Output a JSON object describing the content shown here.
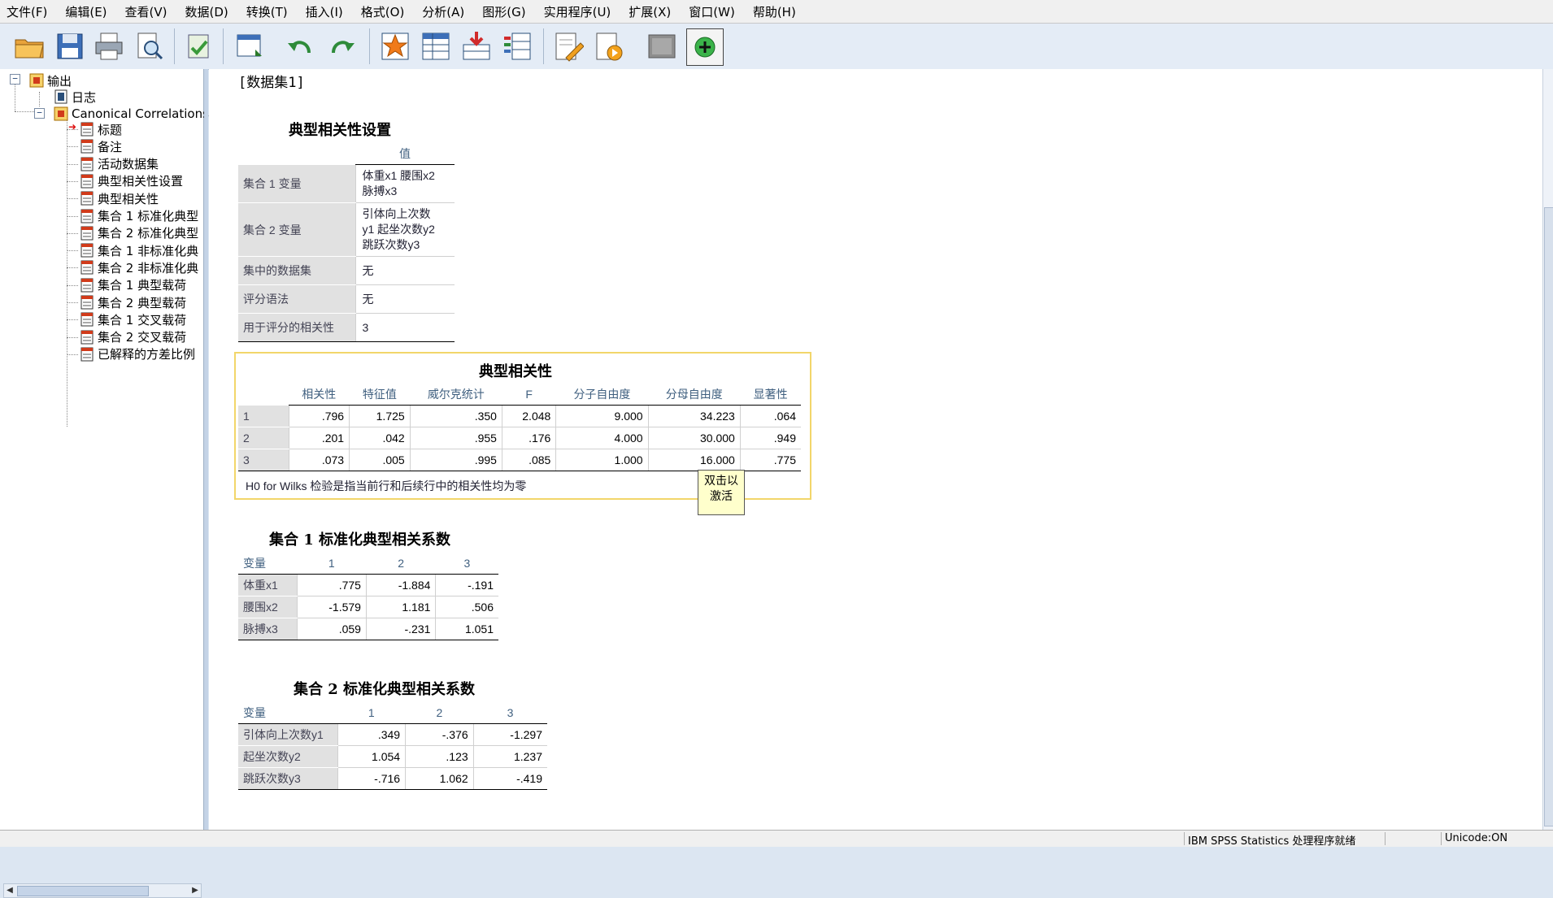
{
  "menu": [
    "文件(F)",
    "编辑(E)",
    "查看(V)",
    "数据(D)",
    "转换(T)",
    "插入(I)",
    "格式(O)",
    "分析(A)",
    "图形(G)",
    "实用程序(U)",
    "扩展(X)",
    "窗口(W)",
    "帮助(H)"
  ],
  "toolbar": {
    "icons": [
      "open-icon",
      "save-icon",
      "print-icon",
      "print-preview-icon",
      "export-icon",
      "goto-data-icon",
      "undo-icon",
      "redo-icon",
      "goto-case-icon",
      "goto-variable-icon",
      "insert-output-icon",
      "select-cases-icon",
      "edit-icon",
      "designate-window-icon",
      "hide-icon",
      "run-icon"
    ]
  },
  "tree": {
    "root": "输出",
    "log": "日志",
    "analysis": "Canonical Correlations",
    "items": [
      "标题",
      "备注",
      "活动数据集",
      "典型相关性设置",
      "典型相关性",
      "集合 1 标准化典型",
      "集合 2 标准化典型",
      "集合 1 非标准化典",
      "集合 2 非标准化典",
      "集合 1 典型载荷",
      "集合 2 典型载荷",
      "集合 1 交叉载荷",
      "集合 2 交叉载荷",
      "已解释的方差比例"
    ]
  },
  "output": {
    "dataset": "[数据集1]",
    "settings": {
      "title": "典型相关性设置",
      "value_header": "值",
      "rows": [
        {
          "label": "集合 1 变量",
          "value": "体重x1 腰围x2\n脉搏x3"
        },
        {
          "label": "集合 2 变量",
          "value": "引体向上次数\ny1 起坐次数y2\n跳跃次数y3"
        },
        {
          "label": "集中的数据集",
          "value": "无"
        },
        {
          "label": "评分语法",
          "value": "无"
        },
        {
          "label": "用于评分的相关性",
          "value": "3"
        }
      ]
    },
    "canon": {
      "title": "典型相关性",
      "headers": [
        "相关性",
        "特征值",
        "威尔克统计",
        "F",
        "分子自由度",
        "分母自由度",
        "显著性"
      ],
      "rows": [
        {
          "id": "1",
          "cells": [
            ".796",
            "1.725",
            ".350",
            "2.048",
            "9.000",
            "34.223",
            ".064"
          ]
        },
        {
          "id": "2",
          "cells": [
            ".201",
            ".042",
            ".955",
            ".176",
            "4.000",
            "30.000",
            ".949"
          ]
        },
        {
          "id": "3",
          "cells": [
            ".073",
            ".005",
            ".995",
            ".085",
            "1.000",
            "16.000",
            ".775"
          ]
        }
      ],
      "footnote": "H0 for Wilks 检验是指当前行和后续行中的相关性均为零",
      "tooltip_line1": "双击以",
      "tooltip_line2": "激活"
    },
    "set1": {
      "title": "集合 1 标准化典型相关系数",
      "var_header": "变量",
      "cols": [
        "1",
        "2",
        "3"
      ],
      "rows": [
        {
          "label": "体重x1",
          "cells": [
            ".775",
            "-1.884",
            "-.191"
          ]
        },
        {
          "label": "腰围x2",
          "cells": [
            "-1.579",
            "1.181",
            ".506"
          ]
        },
        {
          "label": "脉搏x3",
          "cells": [
            ".059",
            "-.231",
            "1.051"
          ]
        }
      ]
    },
    "set2": {
      "title": "集合 2 标准化典型相关系数",
      "var_header": "变量",
      "cols": [
        "1",
        "2",
        "3"
      ],
      "rows": [
        {
          "label": "引体向上次数y1",
          "cells": [
            ".349",
            "-.376",
            "-1.297"
          ]
        },
        {
          "label": "起坐次数y2",
          "cells": [
            "1.054",
            ".123",
            "1.237"
          ]
        },
        {
          "label": "跳跃次数y3",
          "cells": [
            "-.716",
            "1.062",
            "-.419"
          ]
        }
      ]
    }
  },
  "status": {
    "processor": "IBM SPSS Statistics 处理程序就绪",
    "unicode": "Unicode:ON"
  }
}
